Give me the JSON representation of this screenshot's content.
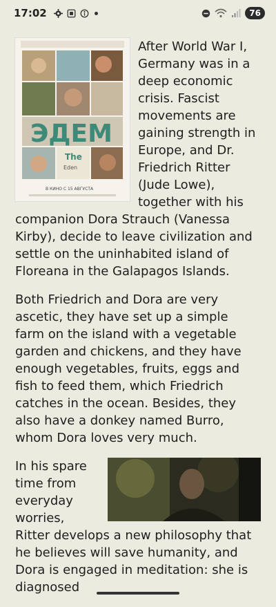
{
  "status_bar": {
    "time": "17:02",
    "battery": "76",
    "left_icons": [
      "gear-icon",
      "screenshot-icon",
      "accessibility-icon",
      "notification-dot"
    ],
    "right_icons": [
      "dnd-icon",
      "wifi-icon",
      "signal-icon",
      "battery-icon"
    ]
  },
  "article": {
    "poster": {
      "title": "ЭДЕМ",
      "subtitle": "The",
      "subtitle2": "Eden",
      "release_text": "В КИНО С 15 АВГУСТА"
    },
    "paragraphs": [
      "After World War I, Germany was in a deep economic crisis. Fascist movements are gaining strength in Europe, and Dr. Friedrich Ritter (Jude Lowe), together with his companion Dora Strauch (Vanessa Kirby), decide to leave civilization and settle on the uninhabited island of Floreana in the Galapagos Islands.",
      "Both Friedrich and Dora are very ascetic, they have set up a simple farm on the island with a vegetable garden and chickens, and they have enough vegetables, fruits, eggs and fish to feed them, which Friedrich catches in the ocean. Besides, they also have a donkey named Burro, whom Dora loves very much.",
      "In his spare time from everyday worries, Ritter develops a new philosophy that he believes will save humanity, and Dora is engaged in meditation: she is diagnosed"
    ]
  },
  "colors": {
    "background": "#ecebe0",
    "text": "#1e1e1e"
  }
}
